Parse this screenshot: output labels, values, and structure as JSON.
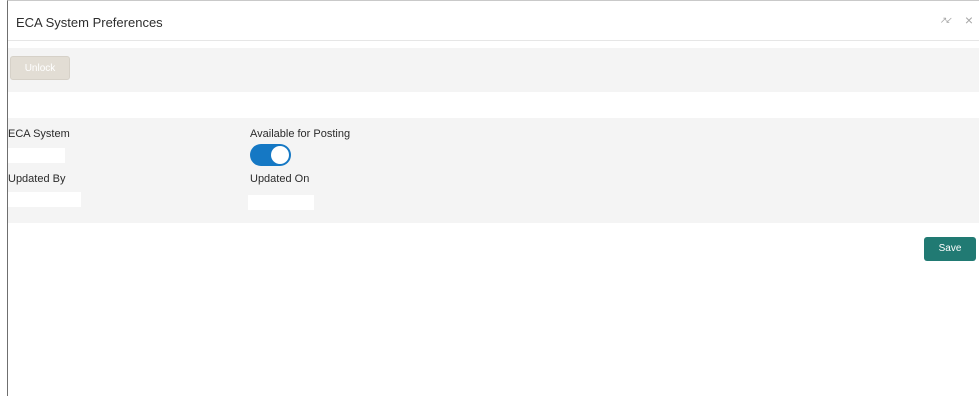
{
  "window": {
    "title": "ECA System Preferences",
    "maximize_icon": "expand-icon",
    "close_icon": "close-icon",
    "maximize_glyph": "↗↙",
    "close_glyph": "×"
  },
  "toolbar": {
    "unlock_label": "Unlock"
  },
  "form": {
    "eca_system_label": "ECA System",
    "eca_system_value": "",
    "available_for_posting_label": "Available for Posting",
    "available_for_posting_on": true,
    "updated_by_label": "Updated By",
    "updated_by_value": "",
    "updated_on_label": "Updated On",
    "updated_on_value": ""
  },
  "footer": {
    "save_label": "Save"
  },
  "colors": {
    "toggle_on": "#1578c4",
    "save_button": "#217a73",
    "unlock_disabled": "#e2ddd4"
  }
}
